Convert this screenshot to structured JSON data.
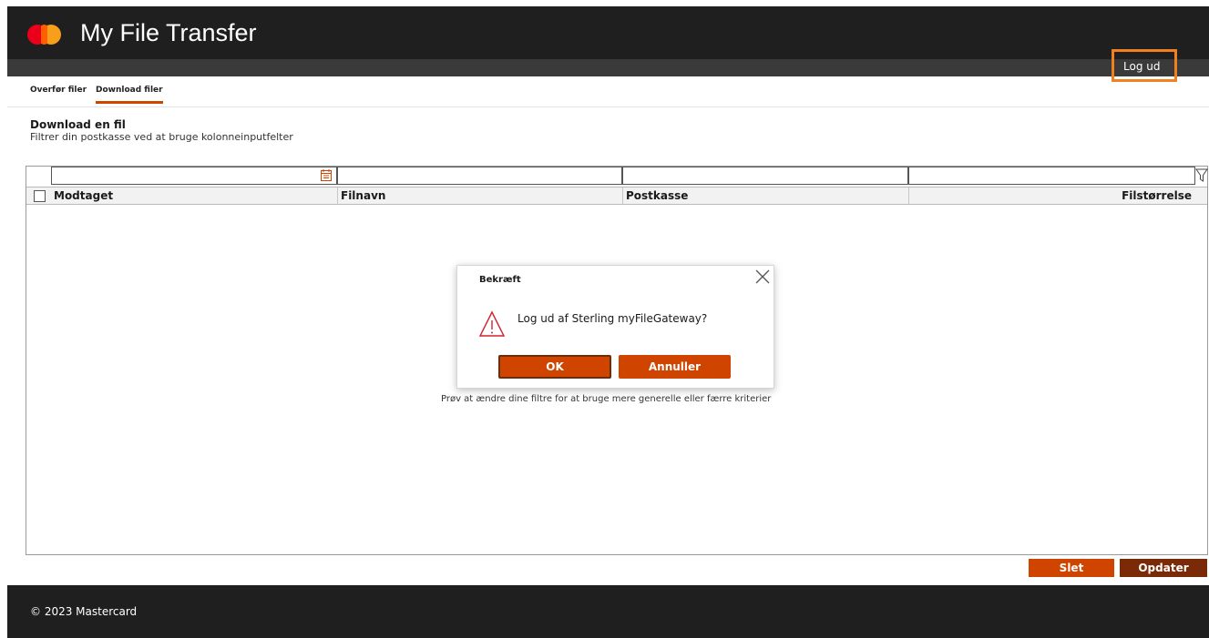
{
  "header": {
    "app_title": "My File Transfer",
    "logout_label": "Log ud"
  },
  "tabs": [
    {
      "label": "Overfør filer"
    },
    {
      "label": "Download filer"
    }
  ],
  "section": {
    "title": "Download en fil",
    "subtitle": "Filtrer din postkasse ved at bruge kolonneinputfelter"
  },
  "table": {
    "columns": [
      "Modtaget",
      "Filnavn",
      "Postkasse",
      "Filstørrelse"
    ],
    "filters": [
      "",
      "",
      "",
      ""
    ],
    "empty_hint": "Prøv at ændre dine filtre for at bruge mere generelle eller færre kriterier"
  },
  "dialog": {
    "title": "Bekræft",
    "message": "Log ud af Sterling myFileGateway?",
    "ok_label": "OK",
    "cancel_label": "Annuller"
  },
  "actions": {
    "delete_label": "Slet",
    "refresh_label": "Opdater"
  },
  "footer": {
    "copyright": "© 2023 Mastercard"
  },
  "colors": {
    "accent": "#cf4500",
    "dark": "#1f1f1f",
    "highlight": "#f08020"
  }
}
